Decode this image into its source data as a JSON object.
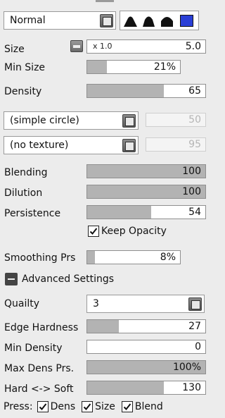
{
  "blend_mode": "Normal",
  "brush_shapes": [
    "shape-soft",
    "shape-medium",
    "shape-hard",
    "shape-square"
  ],
  "selected_shape_index": 3,
  "size": {
    "label": "Size",
    "multiplier": "x 1.0",
    "value": "5.0",
    "fill": 0.0
  },
  "min_size": {
    "label": "Min Size",
    "value": "21%",
    "fill": 0.21
  },
  "density": {
    "label": "Density",
    "value": "65",
    "fill": 0.65
  },
  "brush_tip": {
    "selected": "(simple circle)",
    "value": "50"
  },
  "texture": {
    "selected": "(no texture)",
    "value": "95"
  },
  "blending": {
    "label": "Blending",
    "value": "100",
    "fill": 1.0
  },
  "dilution": {
    "label": "Dilution",
    "value": "100",
    "fill": 1.0
  },
  "persistence": {
    "label": "Persistence",
    "value": "54",
    "fill": 0.54
  },
  "keep_opacity": {
    "label": "Keep Opacity",
    "checked": true
  },
  "smoothing_prs": {
    "label": "Smoothing Prs",
    "value": "8%",
    "fill": 0.08
  },
  "advanced": {
    "label": "Advanced Settings"
  },
  "quality": {
    "label": "Quailty",
    "selected": "3"
  },
  "edge_hardness": {
    "label": "Edge Hardness",
    "value": "27",
    "fill": 0.27
  },
  "min_density": {
    "label": "Min Density",
    "value": "0",
    "fill": 0.0
  },
  "max_dens_prs": {
    "label": "Max Dens Prs.",
    "value": "100%",
    "fill": 1.0
  },
  "hard_soft": {
    "label": "Hard <-> Soft",
    "value": "130",
    "fill": 0.65
  },
  "press": {
    "label": "Press:",
    "dens": "Dens",
    "size": "Size",
    "blend": "Blend"
  },
  "colors": {
    "fill": "#b3b3b3",
    "selected_shape": "#2a3fd6"
  }
}
